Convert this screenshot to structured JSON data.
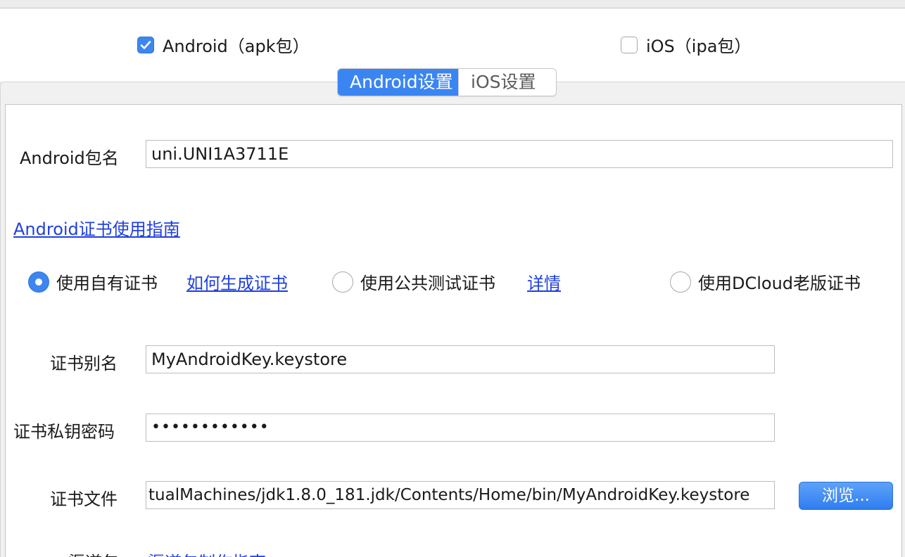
{
  "platforms": {
    "android": {
      "label": "Android（apk包）",
      "checked": true
    },
    "ios": {
      "label": "iOS（ipa包）",
      "checked": false
    }
  },
  "tabs": [
    {
      "label": "Android设置",
      "active": true
    },
    {
      "label": "iOS设置",
      "active": false
    }
  ],
  "package_name": {
    "label": "Android包名",
    "value": "uni.UNI1A3711E"
  },
  "cert_guide_link": "Android证书使用指南",
  "cert_options": [
    {
      "label": "使用自有证书",
      "selected": true
    },
    {
      "label": "使用公共测试证书",
      "selected": false
    },
    {
      "label": "使用DCloud老版证书",
      "selected": false
    }
  ],
  "cert_links": {
    "how_to_generate": "如何生成证书",
    "details": "详情"
  },
  "cert_alias": {
    "label": "证书别名",
    "value": "MyAndroidKey.keystore"
  },
  "cert_password": {
    "label": "证书私钥密码",
    "value": "••••••••••••"
  },
  "cert_file": {
    "label": "证书文件",
    "value": "tualMachines/jdk1.8.0_181.jdk/Contents/Home/bin/MyAndroidKey.keystore",
    "browse_label": "浏览..."
  },
  "channel": {
    "label": "渠道包",
    "guide_link": "渠道包制作指南"
  },
  "colors": {
    "accent": "#3a85f2",
    "link": "#1f3fe0"
  }
}
